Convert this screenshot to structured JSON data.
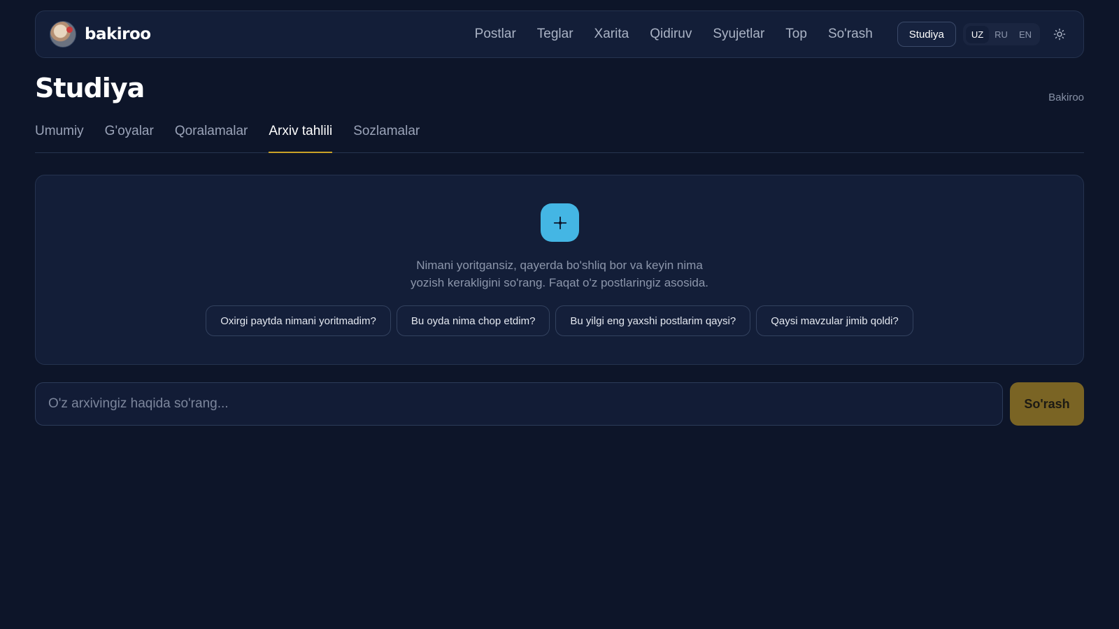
{
  "header": {
    "brand": "bakiroo",
    "nav": [
      "Postlar",
      "Teglar",
      "Xarita",
      "Qidiruv",
      "Syujetlar",
      "Top",
      "So'rash"
    ],
    "studio_button": "Studiya",
    "languages": [
      "UZ",
      "RU",
      "EN"
    ],
    "active_language": "UZ",
    "theme_icon": "sun-icon"
  },
  "page": {
    "title": "Studiya",
    "breadcrumb": "Bakiroo"
  },
  "tabs": {
    "items": [
      "Umumiy",
      "G'oyalar",
      "Qoralamalar",
      "Arxiv tahlili",
      "Sozlamalar"
    ],
    "active": "Arxiv tahlili"
  },
  "panel": {
    "icon": "sparkle-icon",
    "intro_line1": "Nimani yoritgansiz, qayerda bo'shliq bor va keyin nima",
    "intro_line2": "yozish kerakligini so'rang. Faqat o'z postlaringiz asosida.",
    "suggestions": [
      "Oxirgi paytda nimani yoritmadim?",
      "Bu oyda nima chop etdim?",
      "Bu yilgi eng yaxshi postlarim qaysi?",
      "Qaysi mavzular jimib qoldi?"
    ]
  },
  "ask": {
    "placeholder": "O'z arxivingiz haqida so'rang...",
    "value": "",
    "button": "So'rash"
  },
  "colors": {
    "background": "#0d1529",
    "surface": "#131e38",
    "accent_gold": "#c9a227",
    "ask_button": "#7a6424",
    "spark_blue": "#44b6e4"
  }
}
